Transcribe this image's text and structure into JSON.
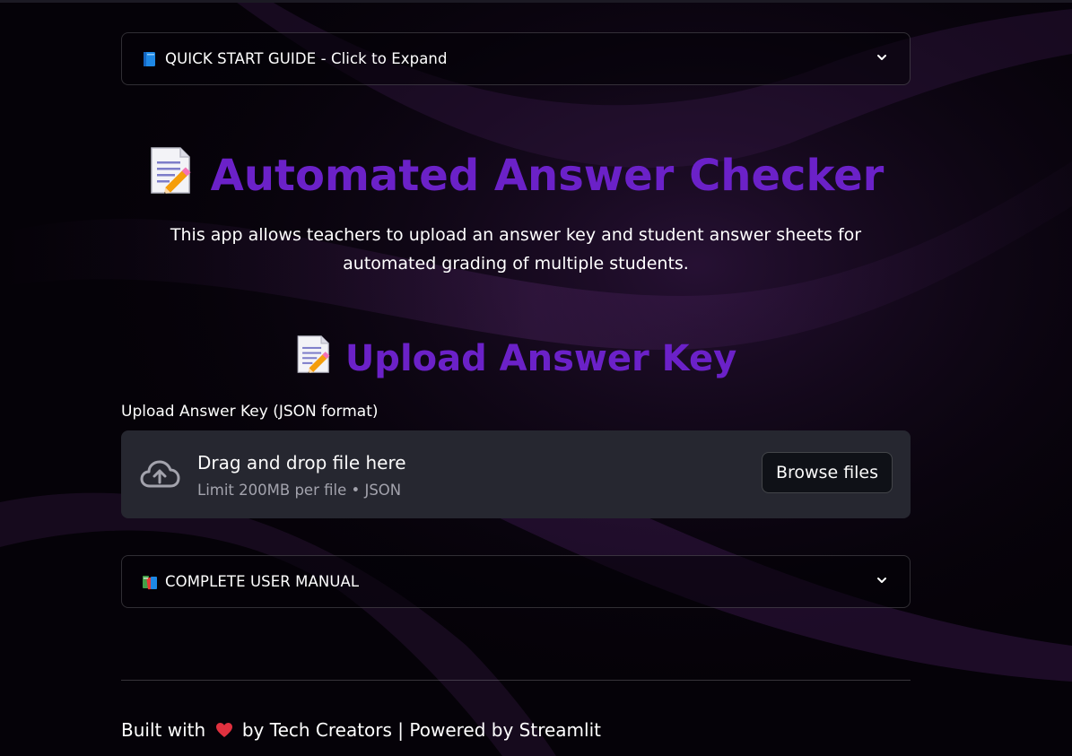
{
  "quick_start": {
    "label": "QUICK START GUIDE - Click to Expand",
    "icon": "blue-book-icon"
  },
  "header": {
    "title": "Automated Answer Checker",
    "title_icon": "memo-icon",
    "description": "This app allows teachers to upload an answer key and student answer sheets for automated grading of multiple students."
  },
  "upload_section": {
    "title": "Upload Answer Key",
    "title_icon": "memo-icon",
    "uploader_label": "Upload Answer Key (JSON format)",
    "drop_text": "Drag and drop file here",
    "limit_text": "Limit 200MB per file • JSON",
    "browse_label": "Browse files",
    "upload_icon": "cloud-upload-icon"
  },
  "user_manual": {
    "label": "COMPLETE USER MANUAL",
    "icon": "books-icon"
  },
  "footer": {
    "built_with": "Built with",
    "heart_icon": "heart-icon",
    "credit": "by Tech Creators | Powered by Streamlit"
  },
  "colors": {
    "accent_purple": "#6b21c8",
    "background": "#050208",
    "dropzone": "#262730",
    "heart": "#e0313f"
  }
}
